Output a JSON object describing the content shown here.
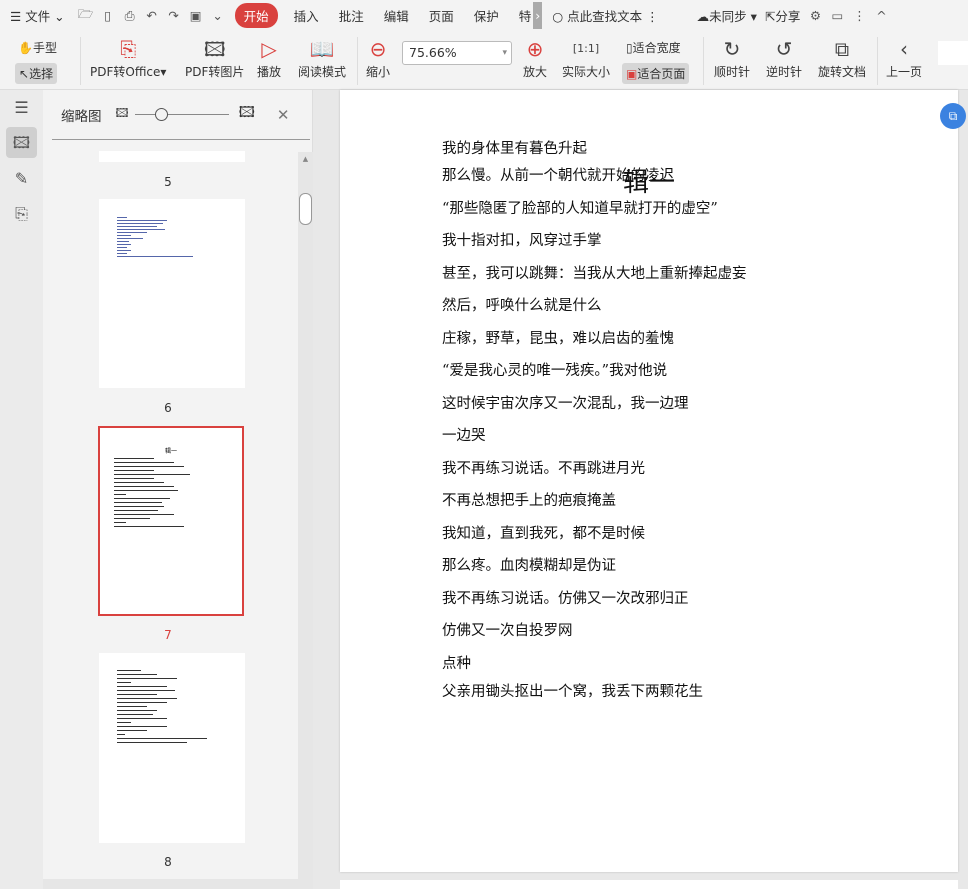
{
  "menu": {
    "file": "文件",
    "tabs": [
      "开始",
      "插入",
      "批注",
      "编辑",
      "页面",
      "保护",
      "特"
    ],
    "search": "点此查找文本",
    "sync": "未同步",
    "share": "分享"
  },
  "toolbar": {
    "hand": "手型",
    "select": "选择",
    "pdf_office": "PDF转Office",
    "pdf_image": "PDF转图片",
    "play": "播放",
    "read_mode": "阅读模式",
    "zoom_out": "缩小",
    "zoom_value": "75.66%",
    "zoom_in": "放大",
    "actual_size": "实际大小",
    "fit_width": "适合宽度",
    "fit_page": "适合页面",
    "clockwise": "顺时针",
    "counter": "逆时针",
    "rotate": "旋转文档",
    "prev": "上一页"
  },
  "thumbs": {
    "title": "缩略图",
    "pages": [
      "5",
      "6",
      "7",
      "8"
    ],
    "current": "7"
  },
  "doc": {
    "title": "辑一",
    "lines": [
      "我的身体里有暮色升起",
      "那么慢。从前一个朝代就开始的凌迟",
      "“那些隐匿了脸部的人知道早就打开的虚空”",
      "我十指对扣，风穿过手掌",
      "甚至，我可以跳舞：当我从大地上重新捧起虚妄",
      "然后，呼唤什么就是什么",
      "庄稼，野草，昆虫，难以启齿的羞愧",
      "“爱是我心灵的唯一残疾。”我对他说",
      "这时候宇宙次序又一次混乱，我一边理",
      "一边哭",
      "我不再练习说话。不再跳进月光",
      "不再总想把手上的疤痕掩盖",
      "我知道，直到我死，都不是时候",
      "那么疼。血肉模糊却是伪证",
      "我不再练习说话。仿佛又一次改邪归正",
      "仿佛又一次自投罗网",
      "点种",
      "父亲用锄头抠出一个窝，我丢下两颗花生"
    ]
  }
}
